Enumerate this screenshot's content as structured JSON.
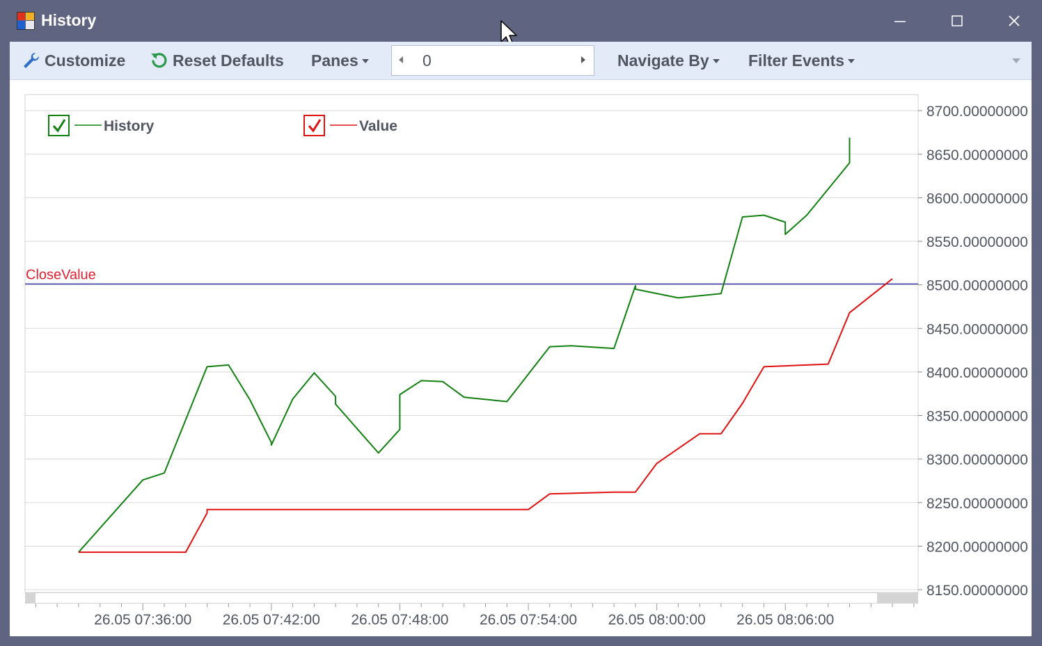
{
  "window": {
    "title": "History",
    "controls": {
      "minimize": "minimize-icon",
      "maximize": "maximize-icon",
      "close": "close-icon"
    }
  },
  "toolbar": {
    "customize_label": "Customize",
    "reset_label": "Reset Defaults",
    "panes_label": "Panes",
    "spinner_value": "0",
    "navigate_label": "Navigate By",
    "filter_label": "Filter Events"
  },
  "colors": {
    "history": "#118011",
    "value": "#e01010",
    "close_line": "#1a1aa0",
    "close_label": "#e02030",
    "grid": "#d8d8d8"
  },
  "chart_data": {
    "type": "line",
    "legend": [
      {
        "name": "History",
        "checked": true,
        "color": "#118011"
      },
      {
        "name": "Value",
        "checked": true,
        "color": "#e01010"
      }
    ],
    "legend_position": "top-left",
    "y_axis_position": "right",
    "ylim": [
      8150,
      8700
    ],
    "y_ticks": [
      8700,
      8650,
      8600,
      8550,
      8500,
      8450,
      8400,
      8350,
      8300,
      8250,
      8200,
      8150
    ],
    "y_tick_labels": [
      "8700.00000000",
      "8650.00000000",
      "8600.00000000",
      "8550.00000000",
      "8500.00000000",
      "8450.00000000",
      "8400.00000000",
      "8350.00000000",
      "8300.00000000",
      "8250.00000000",
      "8200.00000000",
      "8150.00000000"
    ],
    "x_tick_labels": [
      "26.05 07:36:00",
      "26.05 07:42:00",
      "26.05 07:48:00",
      "26.05 07:54:00",
      "26.05 08:00:00",
      "26.05 08:06:00"
    ],
    "x_ticks_minutes": [
      456,
      462,
      468,
      474,
      480,
      486
    ],
    "xlim_minutes": [
      450.5,
      492.2
    ],
    "grid": true,
    "reference_line": {
      "label": "CloseValue",
      "value": 8501
    },
    "series": [
      {
        "name": "History",
        "x_minutes": [
          453.0,
          456.0,
          457.0,
          459.0,
          460.0,
          461.0,
          462.0,
          462.0,
          463.0,
          464.0,
          465.0,
          465.0,
          466.0,
          467.0,
          468.0,
          468.0,
          469.0,
          470.0,
          471.0,
          473.0,
          475.0,
          476.0,
          478.0,
          479.0,
          479.0,
          481.0,
          483.0,
          484.0,
          485.0,
          486.0,
          486.0,
          487.0,
          489.0,
          489.0
        ],
        "values": [
          8193,
          8276,
          8284,
          8406,
          8408,
          8368,
          8319,
          8316,
          8369,
          8399,
          8372,
          8363,
          8335,
          8307,
          8334,
          8374,
          8390,
          8389,
          8371,
          8366,
          8429,
          8430,
          8427,
          8499,
          8495,
          8485,
          8490,
          8578,
          8580,
          8572,
          8558,
          8580,
          8640,
          8669
        ]
      },
      {
        "name": "Value",
        "x_minutes": [
          453.0,
          458.0,
          459.0,
          459.0,
          474.0,
          475.0,
          478.0,
          479.0,
          480.0,
          482.0,
          483.0,
          484.0,
          485.0,
          488.0,
          488.0,
          489.0,
          491.0
        ],
        "values": [
          8193,
          8193,
          8238,
          8242,
          8242,
          8260,
          8262,
          8262,
          8295,
          8329,
          8329,
          8364,
          8406,
          8409,
          8409,
          8468,
          8507
        ]
      }
    ]
  }
}
